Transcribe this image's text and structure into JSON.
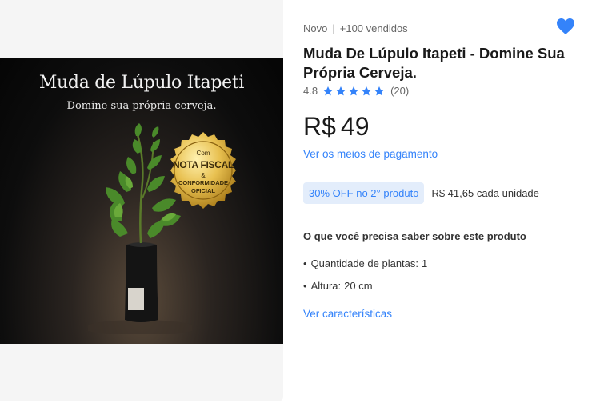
{
  "image": {
    "title": "Muda de Lúpulo Itapeti",
    "subtitle": "Domine sua própria cerveja.",
    "seal": {
      "com": "Com",
      "nota_fiscal": "NOTA FISCAL",
      "amp": "&",
      "conformidade": "CONFORMIDADE",
      "oficial": "OFICIAL"
    }
  },
  "product": {
    "condition": "Novo",
    "sold": "+100 vendidos",
    "title": "Muda De Lúpulo Itapeti - Domine Sua Própria Cerveja.",
    "rating": "4.8",
    "rating_stars": 4.8,
    "reviews": "(20)",
    "currency": "R$",
    "price": "49",
    "payment_link": "Ver os meios de pagamento",
    "promo_badge": "30% OFF no 2° produto",
    "unit_price": "R$ 41,65 cada unidade",
    "features_title": "O que você precisa saber sobre este produto",
    "features": [
      {
        "label": "Quantidade de plantas:",
        "value": "1"
      },
      {
        "label": "Altura:",
        "value": "20 cm"
      }
    ],
    "characteristics_link": "Ver características"
  },
  "colors": {
    "accent": "#3483fa",
    "promo_bg": "#e3edfb",
    "favorite": "#3483fa"
  },
  "icons": {
    "favorite": "heart-icon",
    "rating": "star-icon"
  }
}
